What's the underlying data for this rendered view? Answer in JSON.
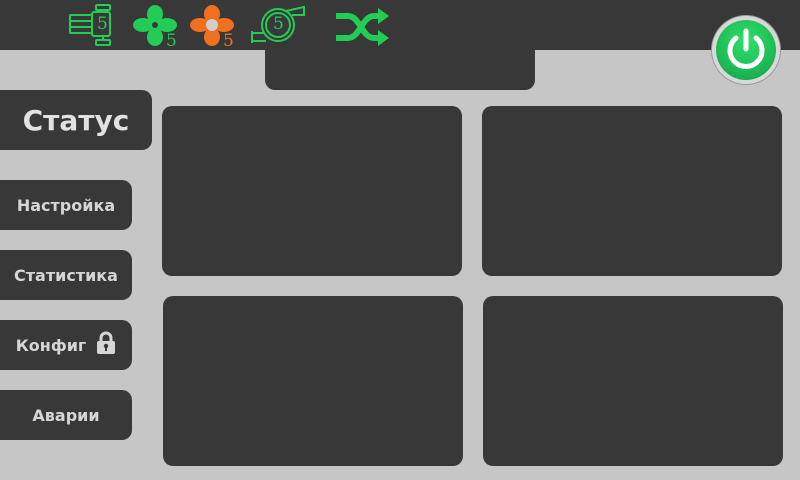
{
  "header": {
    "status_icons": [
      {
        "name": "valve-icon",
        "number": "5"
      },
      {
        "name": "fan-green-icon",
        "number": "5"
      },
      {
        "name": "fan-orange-icon",
        "number": "5"
      },
      {
        "name": "pump-icon",
        "number": "5"
      },
      {
        "name": "shuffle-icon"
      }
    ],
    "power_button": {
      "name": "power-icon"
    }
  },
  "sidebar": {
    "items": [
      {
        "label": "Статус",
        "active": true
      },
      {
        "label": "Настройка"
      },
      {
        "label": "Статистика"
      },
      {
        "label": "Конфиг",
        "icon": "lock-icon"
      },
      {
        "label": "Аварии"
      }
    ]
  },
  "colors": {
    "background": "#c6c6c6",
    "panel": "#383838",
    "green": "#22cc55",
    "orange": "#f07020",
    "text": "#d6d6d6"
  }
}
